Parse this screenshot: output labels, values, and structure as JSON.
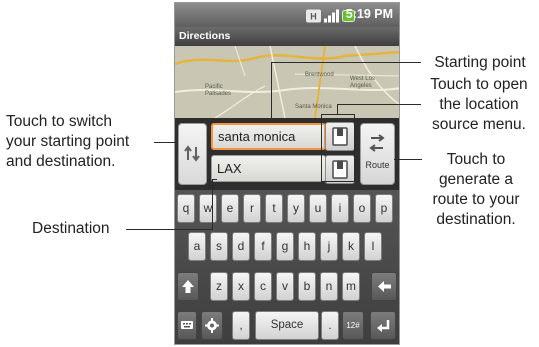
{
  "status_bar": {
    "time": "5:19 PM",
    "icons": [
      "wifi-icon",
      "signal-icon",
      "battery-icon"
    ],
    "battery_color": "#63c12b"
  },
  "app": {
    "title": "Directions"
  },
  "map": {
    "labels": [
      "Pacific Palisades",
      "Brentwood",
      "West Los Angeles",
      "Santa Monica"
    ]
  },
  "route_panel": {
    "start_value": "santa monica",
    "destination_value": "LAX",
    "route_label": "Route",
    "switch_icon": "swap-vertical-icon",
    "location_icon": "location-source-icon",
    "route_icon": "route-arrow-icon",
    "active_field_color": "#f2953e"
  },
  "keyboard": {
    "row1": [
      "q",
      "w",
      "e",
      "r",
      "t",
      "y",
      "u",
      "i",
      "o",
      "p"
    ],
    "row2": [
      "a",
      "s",
      "d",
      "f",
      "g",
      "h",
      "j",
      "k",
      "l"
    ],
    "row3": [
      "z",
      "x",
      "c",
      "v",
      "b",
      "n",
      "m"
    ],
    "bottom": {
      "comma": ",",
      "space": "Space",
      "period": ".",
      "symbols": "12#"
    }
  },
  "callouts": {
    "switch": [
      "Touch to switch",
      "your starting point",
      "and destination."
    ],
    "destination": "Destination",
    "starting_point": "Starting point",
    "location_source": [
      "Touch to open",
      "the location",
      "source menu."
    ],
    "route": [
      "Touch to",
      "generate a",
      "route to your",
      "destination."
    ]
  }
}
